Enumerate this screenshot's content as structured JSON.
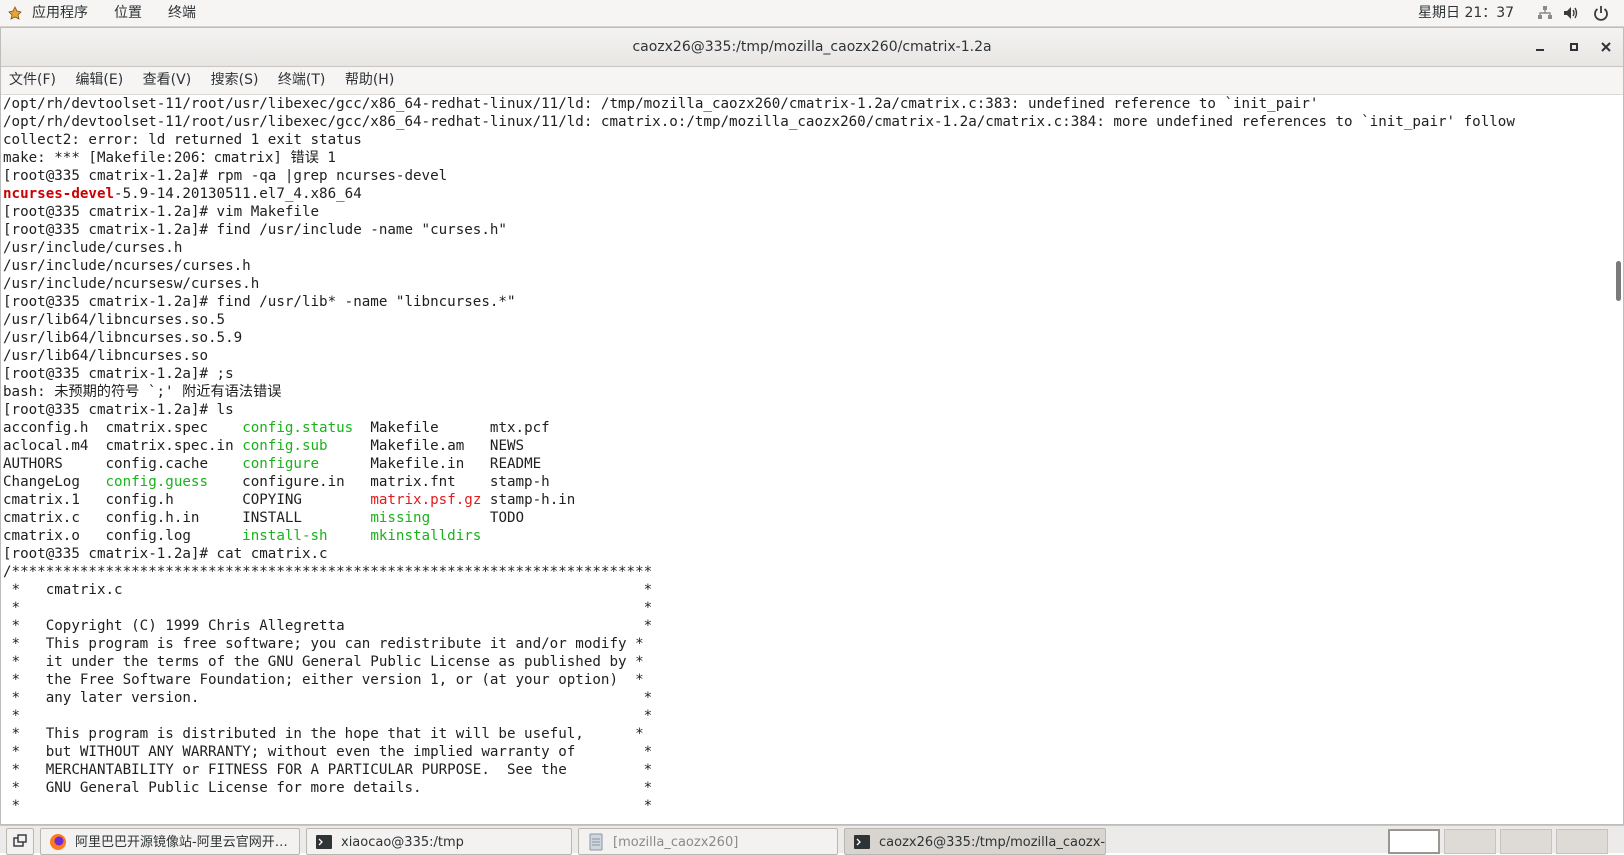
{
  "top_panel": {
    "menus": [
      "应用程序",
      "位置",
      "终端"
    ],
    "clock": "星期日 21：37"
  },
  "window": {
    "title": "caozx26@335:/tmp/mozilla_caozx260/cmatrix-1.2a"
  },
  "menubar": [
    "文件(F)",
    "编辑(E)",
    "查看(V)",
    "搜索(S)",
    "终端(T)",
    "帮助(H)"
  ],
  "terminal": {
    "lines": [
      "/opt/rh/devtoolset-11/root/usr/libexec/gcc/x86_64-redhat-linux/11/ld: /tmp/mozilla_caozx260/cmatrix-1.2a/cmatrix.c:383: undefined reference to `init_pair'",
      "/opt/rh/devtoolset-11/root/usr/libexec/gcc/x86_64-redhat-linux/11/ld: cmatrix.o:/tmp/mozilla_caozx260/cmatrix-1.2a/cmatrix.c:384: more undefined references to `init_pair' follow",
      "collect2: error: ld returned 1 exit status",
      "make: *** [Makefile:206：cmatrix] 错误 1",
      "[root@335 cmatrix-1.2a]# rpm -qa |grep ncurses-devel",
      "",
      "[root@335 cmatrix-1.2a]# vim Makefile",
      "[root@335 cmatrix-1.2a]# find /usr/include -name \"curses.h\"",
      "/usr/include/curses.h",
      "/usr/include/ncurses/curses.h",
      "/usr/include/ncursesw/curses.h",
      "[root@335 cmatrix-1.2a]# find /usr/lib* -name \"libncurses.*\"",
      "/usr/lib64/libncurses.so.5",
      "/usr/lib64/libncurses.so.5.9",
      "/usr/lib64/libncurses.so",
      "[root@335 cmatrix-1.2a]# ;s",
      "bash: 未预期的符号 `;' 附近有语法错误",
      "[root@335 cmatrix-1.2a]# ls"
    ],
    "rpm_result": {
      "highlight": "ncurses-devel",
      "rest": "-5.9-14.20130511.el7_4.x86_64"
    },
    "ls_rows": [
      [
        {
          "t": "acconfig.h",
          "c": ""
        },
        {
          "t": "cmatrix.spec",
          "c": ""
        },
        {
          "t": "config.status",
          "c": "green"
        },
        {
          "t": "Makefile",
          "c": ""
        },
        {
          "t": "mtx.pcf",
          "c": ""
        }
      ],
      [
        {
          "t": "aclocal.m4",
          "c": ""
        },
        {
          "t": "cmatrix.spec.in",
          "c": ""
        },
        {
          "t": "config.sub",
          "c": "green"
        },
        {
          "t": "Makefile.am",
          "c": ""
        },
        {
          "t": "NEWS",
          "c": ""
        }
      ],
      [
        {
          "t": "AUTHORS",
          "c": ""
        },
        {
          "t": "config.cache",
          "c": ""
        },
        {
          "t": "configure",
          "c": "green"
        },
        {
          "t": "Makefile.in",
          "c": ""
        },
        {
          "t": "README",
          "c": ""
        }
      ],
      [
        {
          "t": "ChangeLog",
          "c": ""
        },
        {
          "t": "config.guess",
          "c": "green"
        },
        {
          "t": "configure.in",
          "c": ""
        },
        {
          "t": "matrix.fnt",
          "c": ""
        },
        {
          "t": "stamp-h",
          "c": ""
        }
      ],
      [
        {
          "t": "cmatrix.1",
          "c": ""
        },
        {
          "t": "config.h",
          "c": ""
        },
        {
          "t": "COPYING",
          "c": ""
        },
        {
          "t": "matrix.psf.gz",
          "c": "red"
        },
        {
          "t": "stamp-h.in",
          "c": ""
        }
      ],
      [
        {
          "t": "cmatrix.c",
          "c": ""
        },
        {
          "t": "config.h.in",
          "c": ""
        },
        {
          "t": "INSTALL",
          "c": ""
        },
        {
          "t": "missing",
          "c": "green"
        },
        {
          "t": "TODO",
          "c": ""
        }
      ],
      [
        {
          "t": "cmatrix.o",
          "c": ""
        },
        {
          "t": "config.log",
          "c": ""
        },
        {
          "t": "install-sh",
          "c": "green"
        },
        {
          "t": "mkinstalldirs",
          "c": "green"
        },
        {
          "t": "",
          "c": ""
        }
      ]
    ],
    "cat_lines": [
      "[root@335 cmatrix-1.2a]# cat cmatrix.c",
      "/***************************************************************************",
      " *   cmatrix.c                                                             *",
      " *                                                                         *",
      " *   Copyright (C) 1999 Chris Allegretta                                   *",
      " *   This program is free software; you can redistribute it and/or modify *",
      " *   it under the terms of the GNU General Public License as published by *",
      " *   the Free Software Foundation; either version 1, or (at your option)  *",
      " *   any later version.                                                    *",
      " *                                                                         *",
      " *   This program is distributed in the hope that it will be useful,      *",
      " *   but WITHOUT ANY WARRANTY; without even the implied warranty of        *",
      " *   MERCHANTABILITY or FITNESS FOR A PARTICULAR PURPOSE.  See the         *",
      " *   GNU General Public License for more details.                          *",
      " *                                                                         *"
    ],
    "colors": {
      "green": "#19b21a",
      "red": "#e01b1b",
      "highlight": "#cc0000"
    }
  },
  "taskbar": {
    "tasks": [
      {
        "label": "阿里巴巴开源镜像站-阿里云官网开…",
        "icon": "firefox-icon",
        "state": "normal"
      },
      {
        "label": "xiaocao@335:/tmp",
        "icon": "terminal-icon",
        "state": "normal"
      },
      {
        "label": "[mozilla_caozx260]",
        "icon": "file-manager-icon",
        "state": "dim"
      },
      {
        "label": "caozx26@335:/tmp/mozilla_caozx-…",
        "icon": "terminal-icon",
        "state": "active"
      }
    ],
    "workspaces": 4
  }
}
